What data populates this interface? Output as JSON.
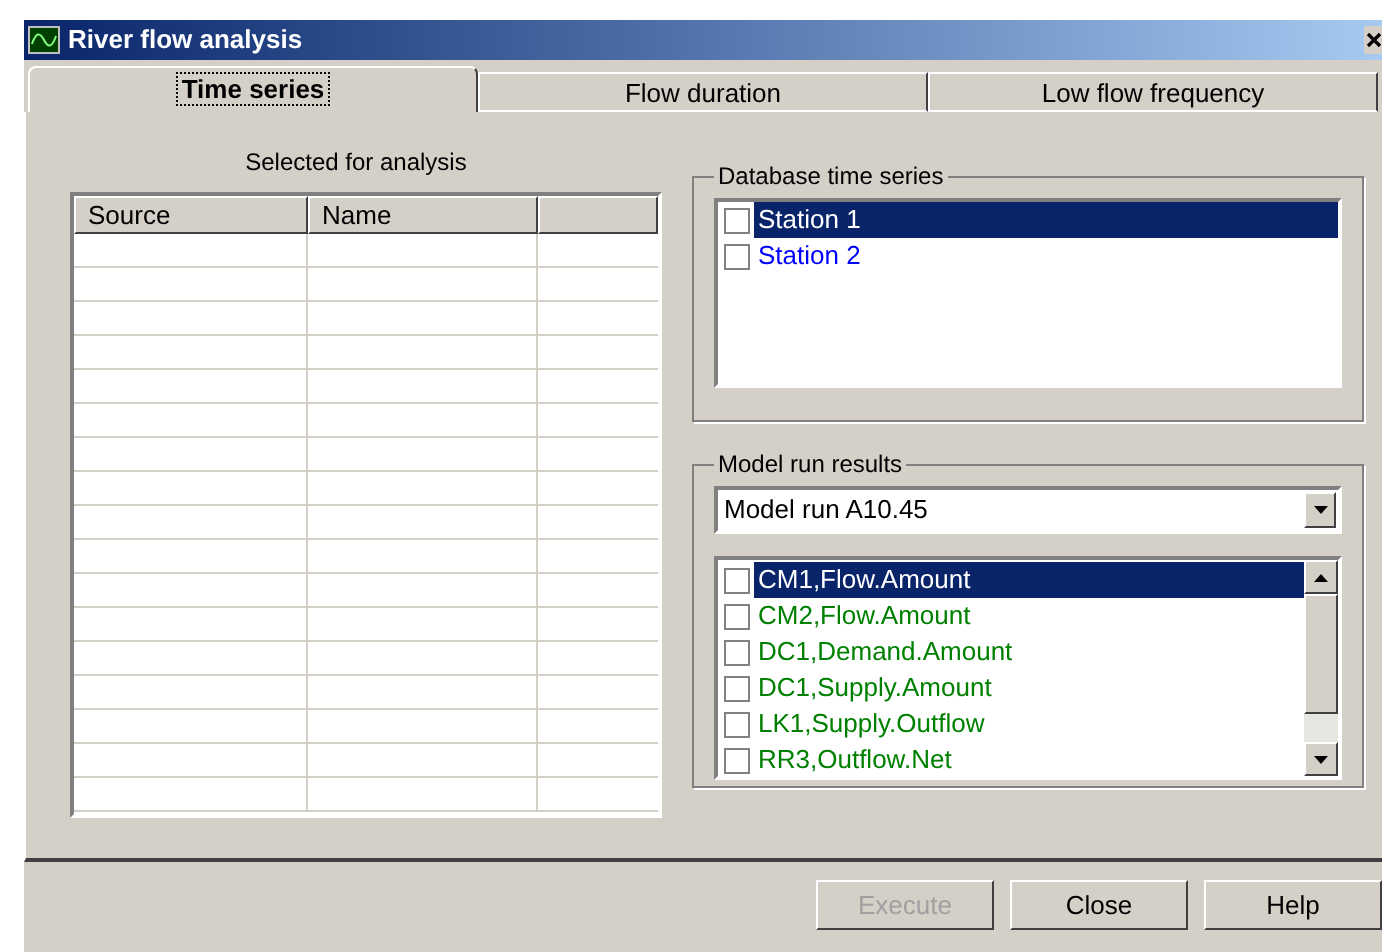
{
  "window": {
    "title": "River flow analysis"
  },
  "tabs": [
    {
      "label": "Time series",
      "selected": true
    },
    {
      "label": "Flow duration",
      "selected": false
    },
    {
      "label": "Low flow frequency",
      "selected": false
    }
  ],
  "selected_for_analysis": {
    "label": "Selected for analysis",
    "columns": [
      "Source",
      "Name"
    ]
  },
  "database_time_series": {
    "label": "Database time series",
    "items": [
      {
        "label": "Station 1",
        "checked": false,
        "selected": true
      },
      {
        "label": "Station 2",
        "checked": false,
        "selected": false,
        "color": "#0000ff"
      }
    ]
  },
  "model_run_results": {
    "label": "Model run results",
    "dropdown": {
      "value": "Model run A10.45"
    },
    "items": [
      {
        "label": "CM1,Flow.Amount",
        "checked": false,
        "selected": true
      },
      {
        "label": "CM2,Flow.Amount",
        "checked": false,
        "selected": false,
        "color": "#008000"
      },
      {
        "label": "DC1,Demand.Amount",
        "checked": false,
        "selected": false,
        "color": "#008000"
      },
      {
        "label": "DC1,Supply.Amount",
        "checked": false,
        "selected": false,
        "color": "#008000"
      },
      {
        "label": "LK1,Supply.Outflow",
        "checked": false,
        "selected": false,
        "color": "#008000"
      },
      {
        "label": "RR3,Outflow.Net",
        "checked": false,
        "selected": false,
        "color": "#008000"
      }
    ]
  },
  "buttons": [
    {
      "label": "Execute",
      "disabled": true
    },
    {
      "label": "Close",
      "disabled": false
    },
    {
      "label": "Help",
      "disabled": false
    }
  ]
}
